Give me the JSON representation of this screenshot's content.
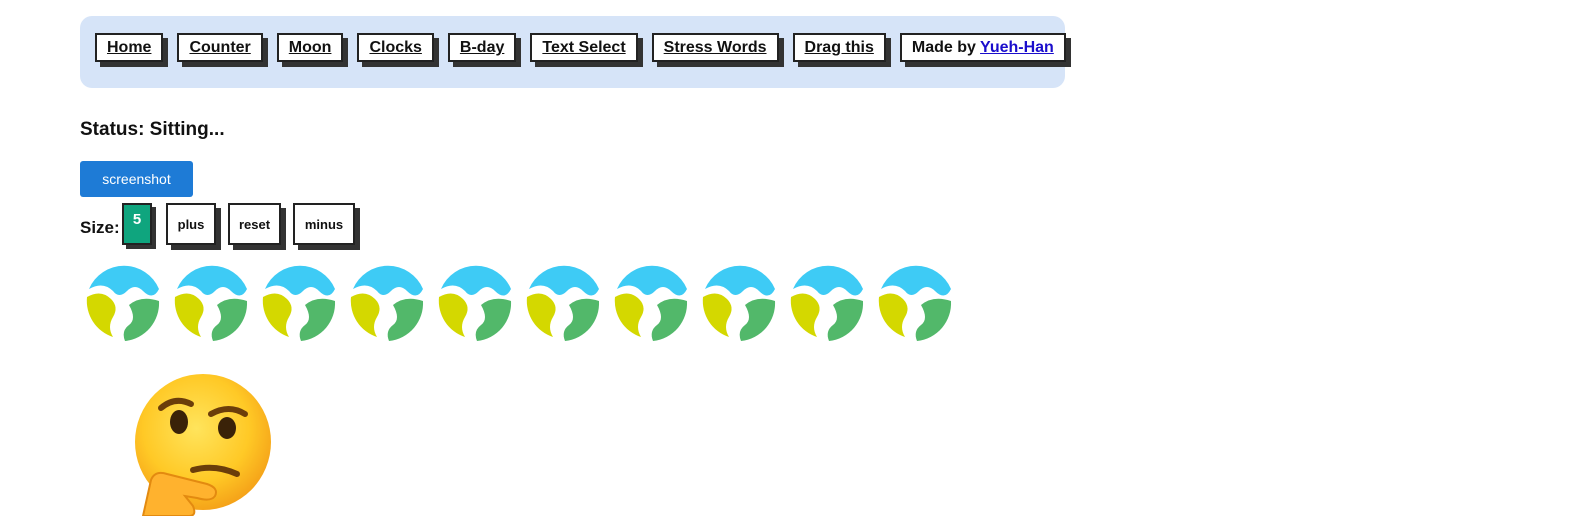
{
  "nav": {
    "items": [
      {
        "label": "Home"
      },
      {
        "label": "Counter"
      },
      {
        "label": "Moon"
      },
      {
        "label": "Clocks"
      },
      {
        "label": "B-day"
      },
      {
        "label": "Text Select"
      },
      {
        "label": "Stress Words"
      },
      {
        "label": "Drag this"
      }
    ],
    "made_by_prefix": "Made by ",
    "made_by_author": "Yueh-Han"
  },
  "status": {
    "text": "Status: Sitting..."
  },
  "screenshot_button": {
    "label": "screenshot"
  },
  "size": {
    "label": "Size:",
    "value": "5",
    "plus_label": "plus",
    "reset_label": "reset",
    "minus_label": "minus"
  },
  "globes": {
    "count": 10,
    "icon": "globe-icon"
  },
  "thinking": {
    "icon": "thinking-face-icon"
  },
  "colors": {
    "nav_bg": "#d6e4f8",
    "screenshot_bg": "#1e7bd6",
    "size_value_bg": "#0fa57e",
    "link": "#1a0dcc"
  }
}
